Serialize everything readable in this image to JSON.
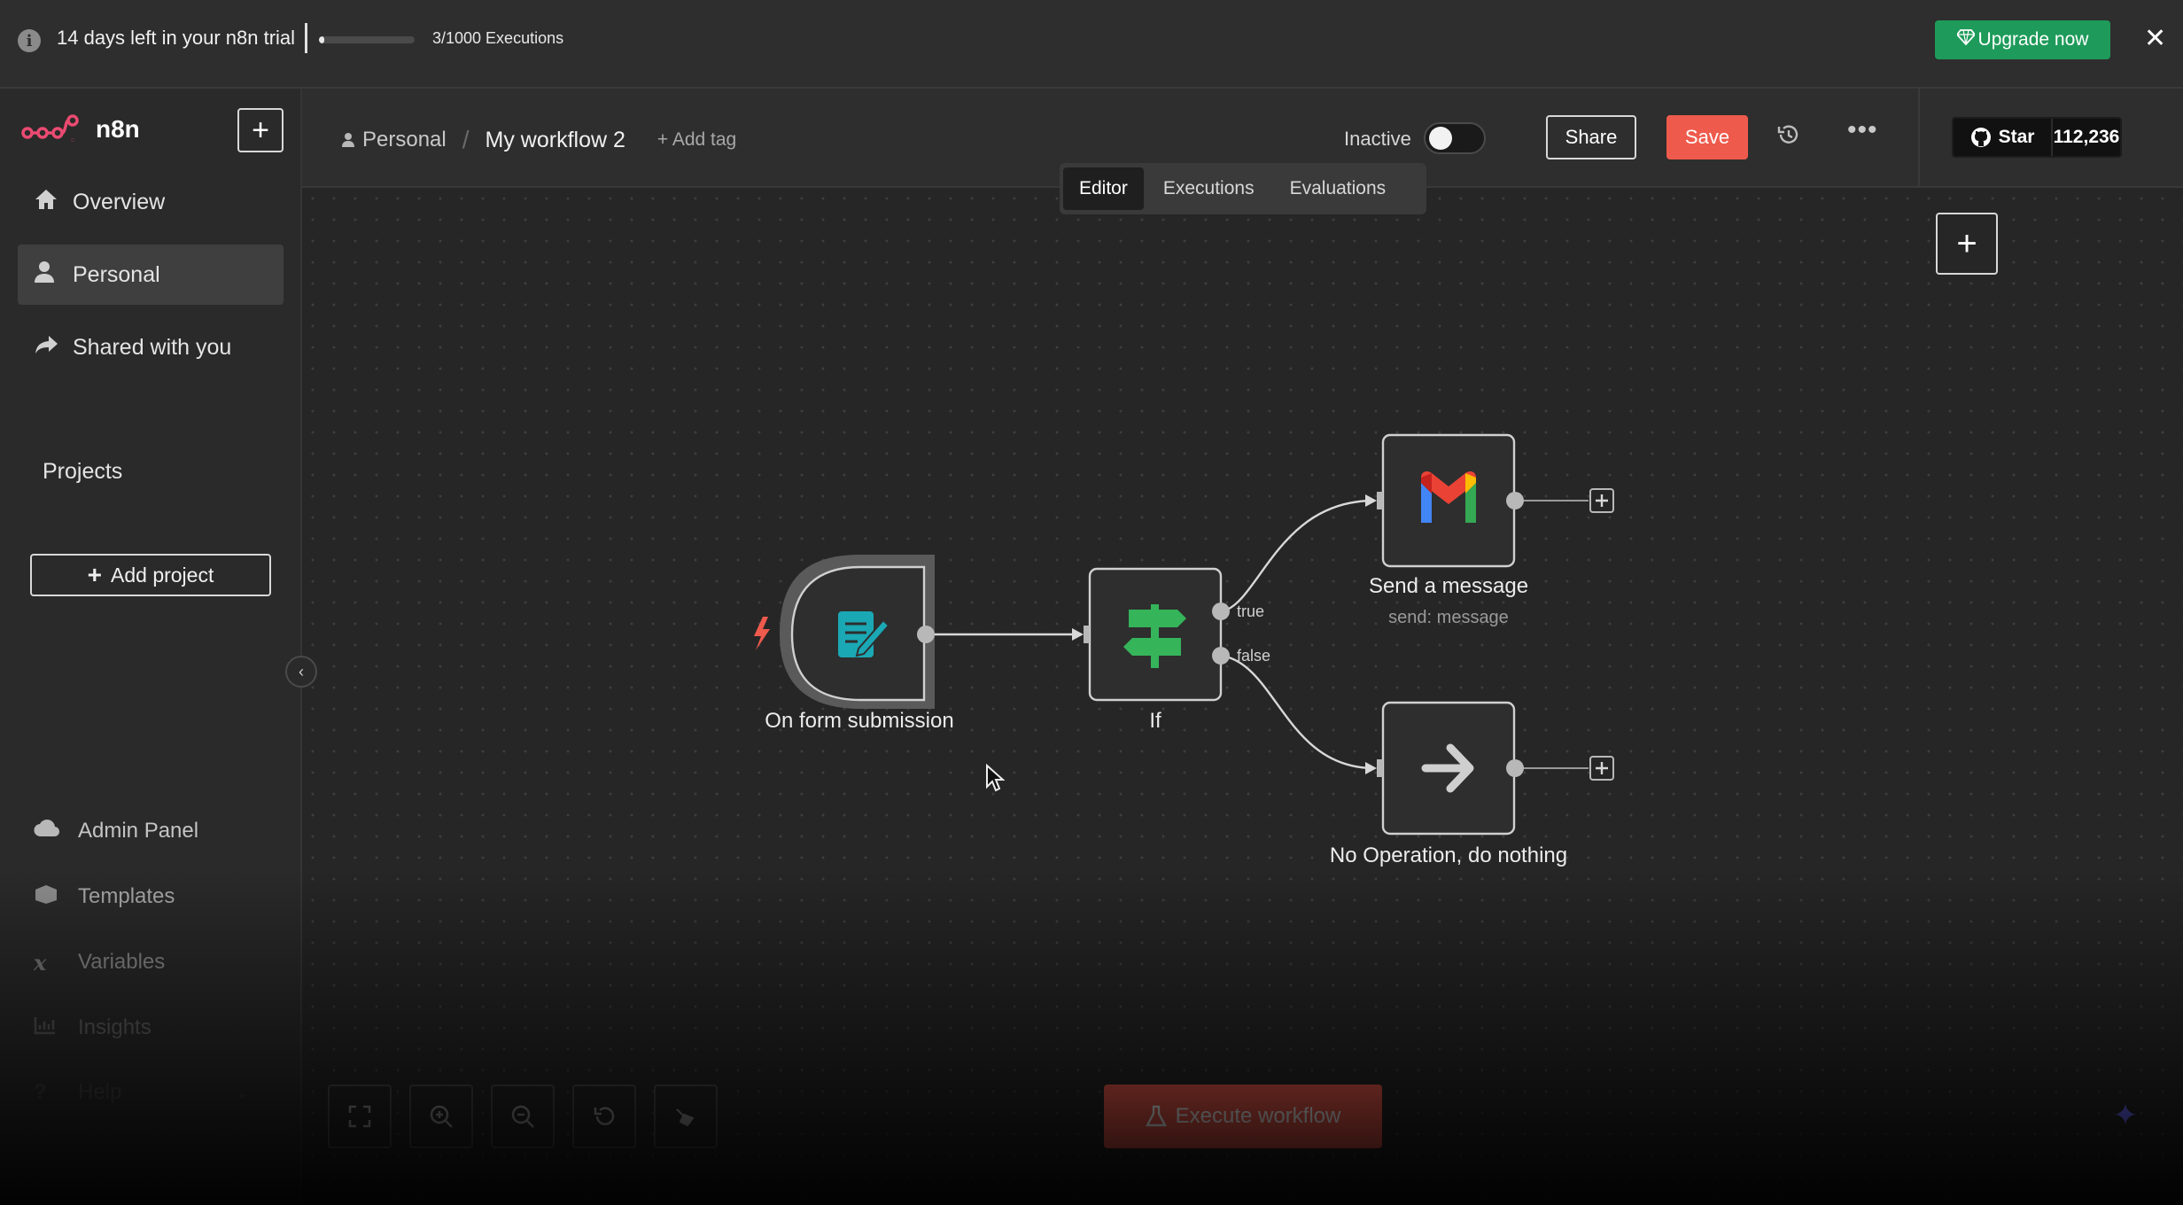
{
  "banner": {
    "trial_text": "14 days left in your n8n trial",
    "executions_progress": 0.003,
    "executions_text": "3/1000 Executions",
    "upgrade_label": "Upgrade now",
    "close_glyph": "✕",
    "info_icon": "info-icon"
  },
  "sidebar": {
    "brand": "n8n",
    "new_glyph": "+",
    "nav": [
      {
        "label": "Overview",
        "icon": "home-icon"
      },
      {
        "label": "Personal",
        "icon": "user-icon"
      },
      {
        "label": "Shared with you",
        "icon": "share-icon"
      }
    ],
    "projects_label": "Projects",
    "add_project_label": "Add project",
    "bottom_nav": [
      {
        "label": "Admin Panel",
        "icon": "cloud-icon"
      },
      {
        "label": "Templates",
        "icon": "box-icon"
      },
      {
        "label": "Variables",
        "icon": "variable-icon"
      },
      {
        "label": "Insights",
        "icon": "chart-icon"
      },
      {
        "label": "Help",
        "icon": "help-icon"
      }
    ]
  },
  "header": {
    "breadcrumb_project": "Personal",
    "workflow_name": "My workflow 2",
    "add_tag": "+ Add tag",
    "status_label": "Inactive",
    "active": false,
    "share_label": "Share",
    "save_label": "Save",
    "github_star_label": "Star",
    "github_star_count": "112,236"
  },
  "tabs": [
    {
      "label": "Editor",
      "active": true
    },
    {
      "label": "Executions",
      "active": false
    },
    {
      "label": "Evaluations",
      "active": false
    }
  ],
  "workflow": {
    "nodes": [
      {
        "name": "On form submission",
        "subtitle": "",
        "icon": "form-icon"
      },
      {
        "name": "If",
        "subtitle": "",
        "icon": "signpost-icon"
      },
      {
        "name": "Send a message",
        "subtitle": "send: message",
        "icon": "gmail-icon"
      },
      {
        "name": "No Operation, do nothing",
        "subtitle": "",
        "icon": "arrow-right-icon"
      }
    ],
    "branch_labels": {
      "true": "true",
      "false": "false"
    }
  },
  "canvas_controls": {
    "execute_label": "Execute workflow"
  },
  "colors": {
    "accent_red": "#ee5a4c",
    "upgrade_green": "#1e9b5a",
    "form_teal": "#1ba8b5",
    "if_green": "#35b45a"
  }
}
